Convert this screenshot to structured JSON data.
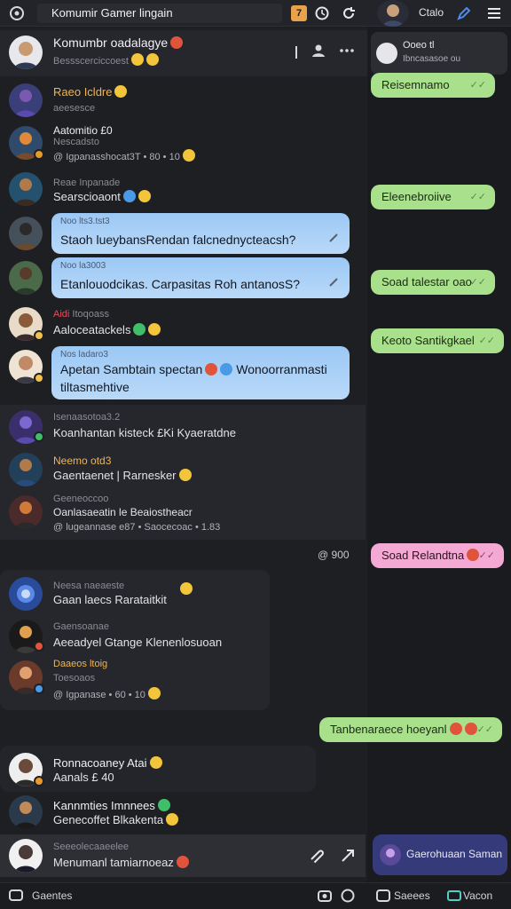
{
  "topbar": {
    "search_text": "Komumir Gamer lingain",
    "badge_label": "7",
    "right_name": "Ctalo"
  },
  "header_row": {
    "name": "Komumbr oadalagye",
    "sub": "Bessscerciccoest"
  },
  "threads": [
    {
      "name": "Raeo Icldre",
      "sub": "aeesesce"
    },
    {
      "name": "Aatomitio £0",
      "sub": "Nescadsto",
      "text": "@ Igpanasshocat3T •  80 • 10"
    },
    {
      "name": "Reae Inpanade",
      "text": "Searscioaont"
    },
    {
      "sub": "Noo lts3.tst3",
      "bubble": "Staoh lueybansRendan falcnednycteacsh?"
    },
    {
      "sub": "Noo la3003",
      "bubble": "Etanlouodcikas. Carpasitas Roh antanosS?"
    },
    {
      "name": "Aidi",
      "sub": "Itoqoass",
      "text": "Aaloceatackels"
    },
    {
      "sub": "Nos ladaro3",
      "bubble": "Apetan Sambtain spectan",
      "bubble_mid": "Wonoorranmasti",
      "bubble2": "tiltasmehtive"
    }
  ],
  "panel_one": [
    {
      "sub": "Isenaasotoa3.2",
      "text": "Koanhantan kisteck £Ki Kyaeratdne"
    },
    {
      "name": "Neemo otd3",
      "text": "Gaentaenet | Rarnesker"
    },
    {
      "sub": "Geeneoccoo",
      "text": "Oanlasaeatin le Beaiostheacr",
      "meta": "@ lugeannase e87 • Saocecoac • 1.83"
    }
  ],
  "panel_two": [
    {
      "sub": "Neesa naeaeste",
      "text": "Gaan laecs Rarataitkit"
    },
    {
      "sub": "Gaensoanae",
      "text": "Aeeadyel Gtange Klenenlosuoan"
    },
    {
      "name": "Daaeos ltoig",
      "sub": "Toesoaos",
      "text": "@ Igpanase • 60 • 10"
    }
  ],
  "bottom_threads": [
    {
      "name": "Ronnacoaney Atai",
      "text": "Aanals £ 40"
    },
    {
      "name": "Kannmties Imnnees",
      "text": "Genecoffet Blkakenta"
    }
  ],
  "composer": {
    "sub": "Seeeolecaaeelee",
    "text": "Menumanl tamiarnoeaz"
  },
  "right_bubbles": [
    {
      "text": "Reisemnamo"
    },
    {
      "text": "Eleenebroiive"
    },
    {
      "text": "Soad talestar oao"
    },
    {
      "text": "Keoto Santikgkael"
    },
    {
      "text": "Soad Relandtna"
    },
    {
      "text": "Tanbenaraece hoeyanl"
    }
  ],
  "side": {
    "card_title": "Ooeo tl",
    "card_sub": "Ibncasasoe ou",
    "button_label": "Gaerohuaan Saman",
    "status_label": "@ 900"
  },
  "bottombar": {
    "left_label": "Gaentes",
    "right_label_a": "Saeees",
    "right_label_b": "Vacon"
  },
  "colors": {
    "accent_blue": "#9cc8f5",
    "accent_green": "#a9e08c",
    "accent_pink": "#f4a8d4",
    "bg": "#1e1f23"
  }
}
